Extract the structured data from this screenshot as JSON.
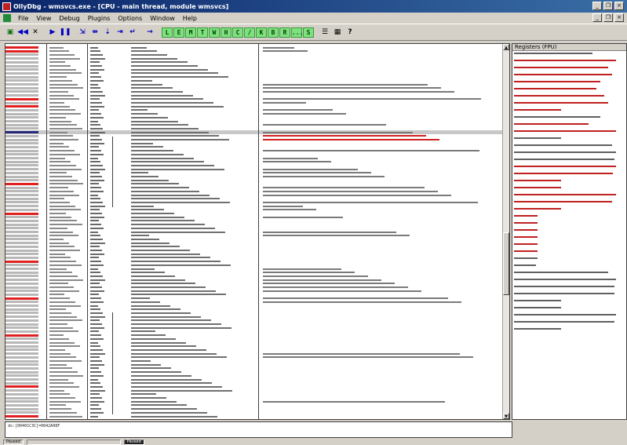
{
  "window": {
    "title": "OllyDbg - wmsvcs.exe - [CPU - main thread, module wmsvcs]",
    "min_label": "_",
    "max_label": "❐",
    "close_label": "×"
  },
  "menu": {
    "items": [
      "File",
      "View",
      "Debug",
      "Plugins",
      "Options",
      "Window",
      "Help"
    ]
  },
  "toolbar": {
    "buttons": [
      "open",
      "restart",
      "close",
      "run",
      "pause",
      "step-into",
      "step-over",
      "trace-into",
      "trace-over",
      "execute-till-return",
      "goto"
    ],
    "letters": [
      "L",
      "E",
      "M",
      "T",
      "W",
      "H",
      "C",
      "/",
      "K",
      "B",
      "R",
      "...",
      "S"
    ],
    "extra": [
      "list-icon",
      "options-icon",
      "help-icon"
    ]
  },
  "registers": {
    "header": "Registers (FPU)"
  },
  "info_pane": {
    "text": "ds:[00401C3C]=0042A08F"
  },
  "status": {
    "left": "Paused",
    "right": "Paused"
  },
  "colors": {
    "title_bg": "#0a246a",
    "breakpoint_red": "#e02020",
    "toolbar_letter_green": "#7ee07e"
  }
}
